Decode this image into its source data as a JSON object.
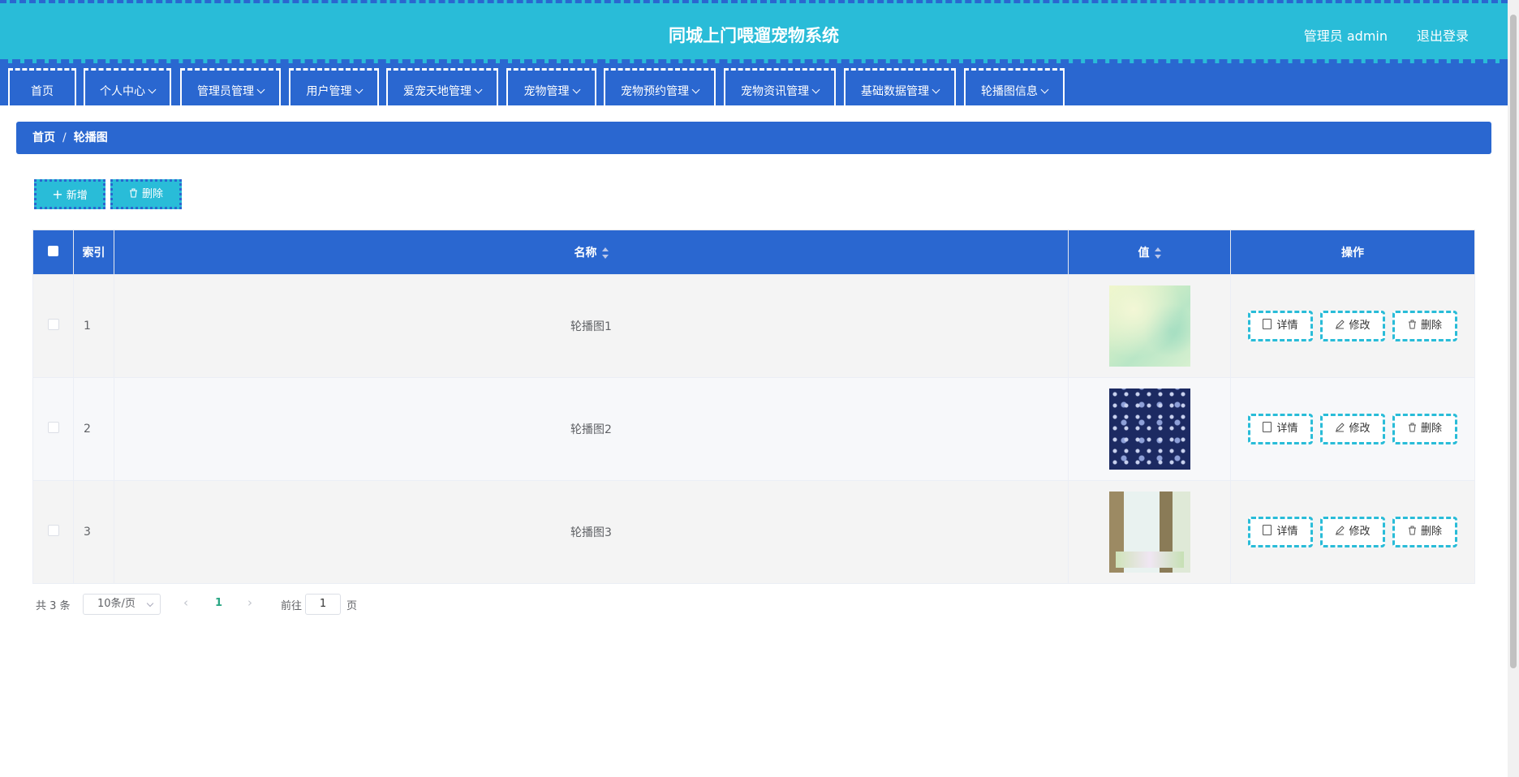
{
  "header": {
    "title": "同城上门喂遛宠物系统",
    "user_label": "管理员 admin",
    "logout_label": "退出登录"
  },
  "nav": {
    "items": [
      {
        "label": "首页",
        "dropdown": false
      },
      {
        "label": "个人中心",
        "dropdown": true
      },
      {
        "label": "管理员管理",
        "dropdown": true
      },
      {
        "label": "用户管理",
        "dropdown": true
      },
      {
        "label": "爱宠天地管理",
        "dropdown": true
      },
      {
        "label": "宠物管理",
        "dropdown": true
      },
      {
        "label": "宠物预约管理",
        "dropdown": true
      },
      {
        "label": "宠物资讯管理",
        "dropdown": true
      },
      {
        "label": "基础数据管理",
        "dropdown": true
      },
      {
        "label": "轮播图信息",
        "dropdown": true
      }
    ]
  },
  "breadcrumb": {
    "home": "首页",
    "separator": "/",
    "current": "轮播图"
  },
  "toolbar": {
    "add_label": "新增",
    "delete_label": "删除"
  },
  "table": {
    "columns": {
      "index": "索引",
      "name": "名称",
      "value": "值",
      "actions": "操作"
    },
    "rows": [
      {
        "index": "1",
        "name": "轮播图1",
        "image": "light green blurred bokeh background"
      },
      {
        "index": "2",
        "name": "轮播图2",
        "image": "navy blue floral pattern"
      },
      {
        "index": "3",
        "name": "轮播图3",
        "image": "trees and pastel meadow"
      }
    ],
    "actions": {
      "detail": "详情",
      "edit": "修改",
      "delete": "删除"
    }
  },
  "pagination": {
    "total": "共 3 条",
    "page_size": "10条/页",
    "current_page": "1",
    "goto_label": "前往",
    "goto_value": "1",
    "page_suffix": "页"
  },
  "colors": {
    "header_bg": "#29bcd8",
    "nav_bg": "#2a67d0",
    "accent": "#29bcd8",
    "pager_active": "#29a683"
  }
}
